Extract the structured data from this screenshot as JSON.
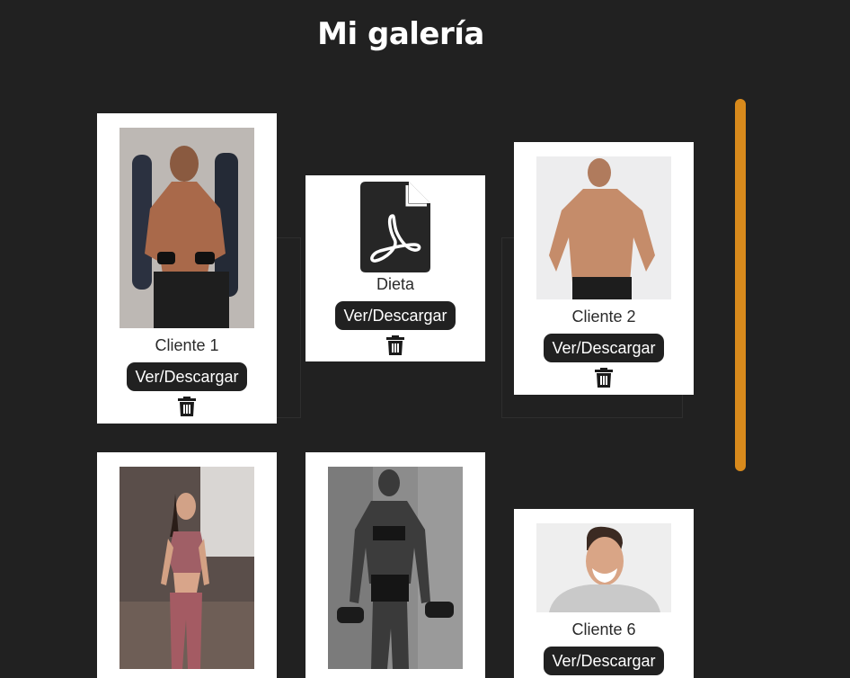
{
  "page": {
    "title": "Mi galería"
  },
  "gallery": {
    "items": [
      {
        "label": "Cliente 1",
        "type": "image",
        "button": "Ver/Descargar"
      },
      {
        "label": "Dieta",
        "type": "pdf",
        "button": "Ver/Descargar"
      },
      {
        "label": "Cliente 2",
        "type": "image",
        "button": "Ver/Descargar"
      },
      {
        "label": "",
        "type": "image",
        "button": ""
      },
      {
        "label": "",
        "type": "image",
        "button": ""
      },
      {
        "label": "Cliente 6",
        "type": "image",
        "button": "Ver/Descargar"
      }
    ]
  },
  "icons": {
    "delete": "trash-icon",
    "document": "pdf-file-icon"
  },
  "colors": {
    "background": "#212121",
    "card": "#ffffff",
    "button": "#212121",
    "scrollbar": "#d88a1c"
  }
}
